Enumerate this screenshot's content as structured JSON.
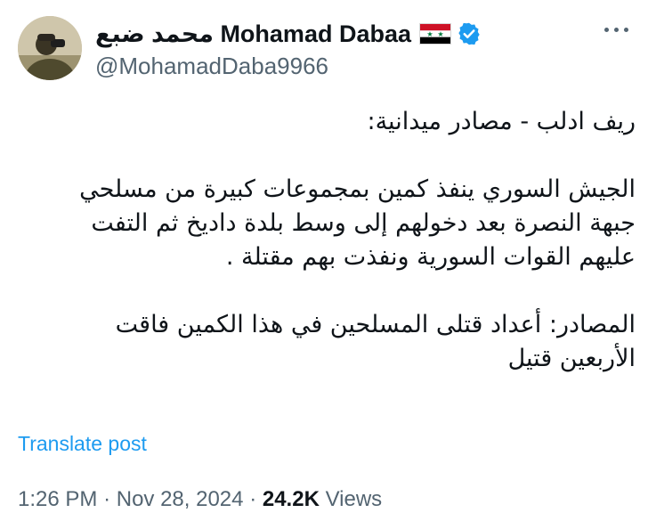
{
  "author": {
    "display_name": "محمد ضبع Mohamad Dabaa",
    "handle": "@MohamadDaba9966",
    "flag_icon": "syria-flag-icon",
    "verified_icon": "verified-badge-icon",
    "verified_color": "#1d9bf0"
  },
  "tweet": {
    "paragraphs": [
      "ريف ادلب - مصادر ميدانية:",
      "الجيش السوري ينفذ كمين بمجموعات كبيرة من مسلحي\nجبهة النصرة بعد دخولهم إلى وسط بلدة داديخ ثم التفت\nعليهم القوات السورية ونفذت بهم مقتلة .",
      "المصادر: أعداد قتلى المسلحين في هذا الكمين فاقت\nالأربعين قتيل"
    ],
    "translate_label": "Translate post",
    "time": "1:26 PM",
    "separator": "·",
    "date": "Nov 28, 2024",
    "views_count": "24.2K",
    "views_label": "Views"
  },
  "colors": {
    "link": "#1d9bf0",
    "secondary_text": "#536471",
    "primary_text": "#0f1419"
  }
}
